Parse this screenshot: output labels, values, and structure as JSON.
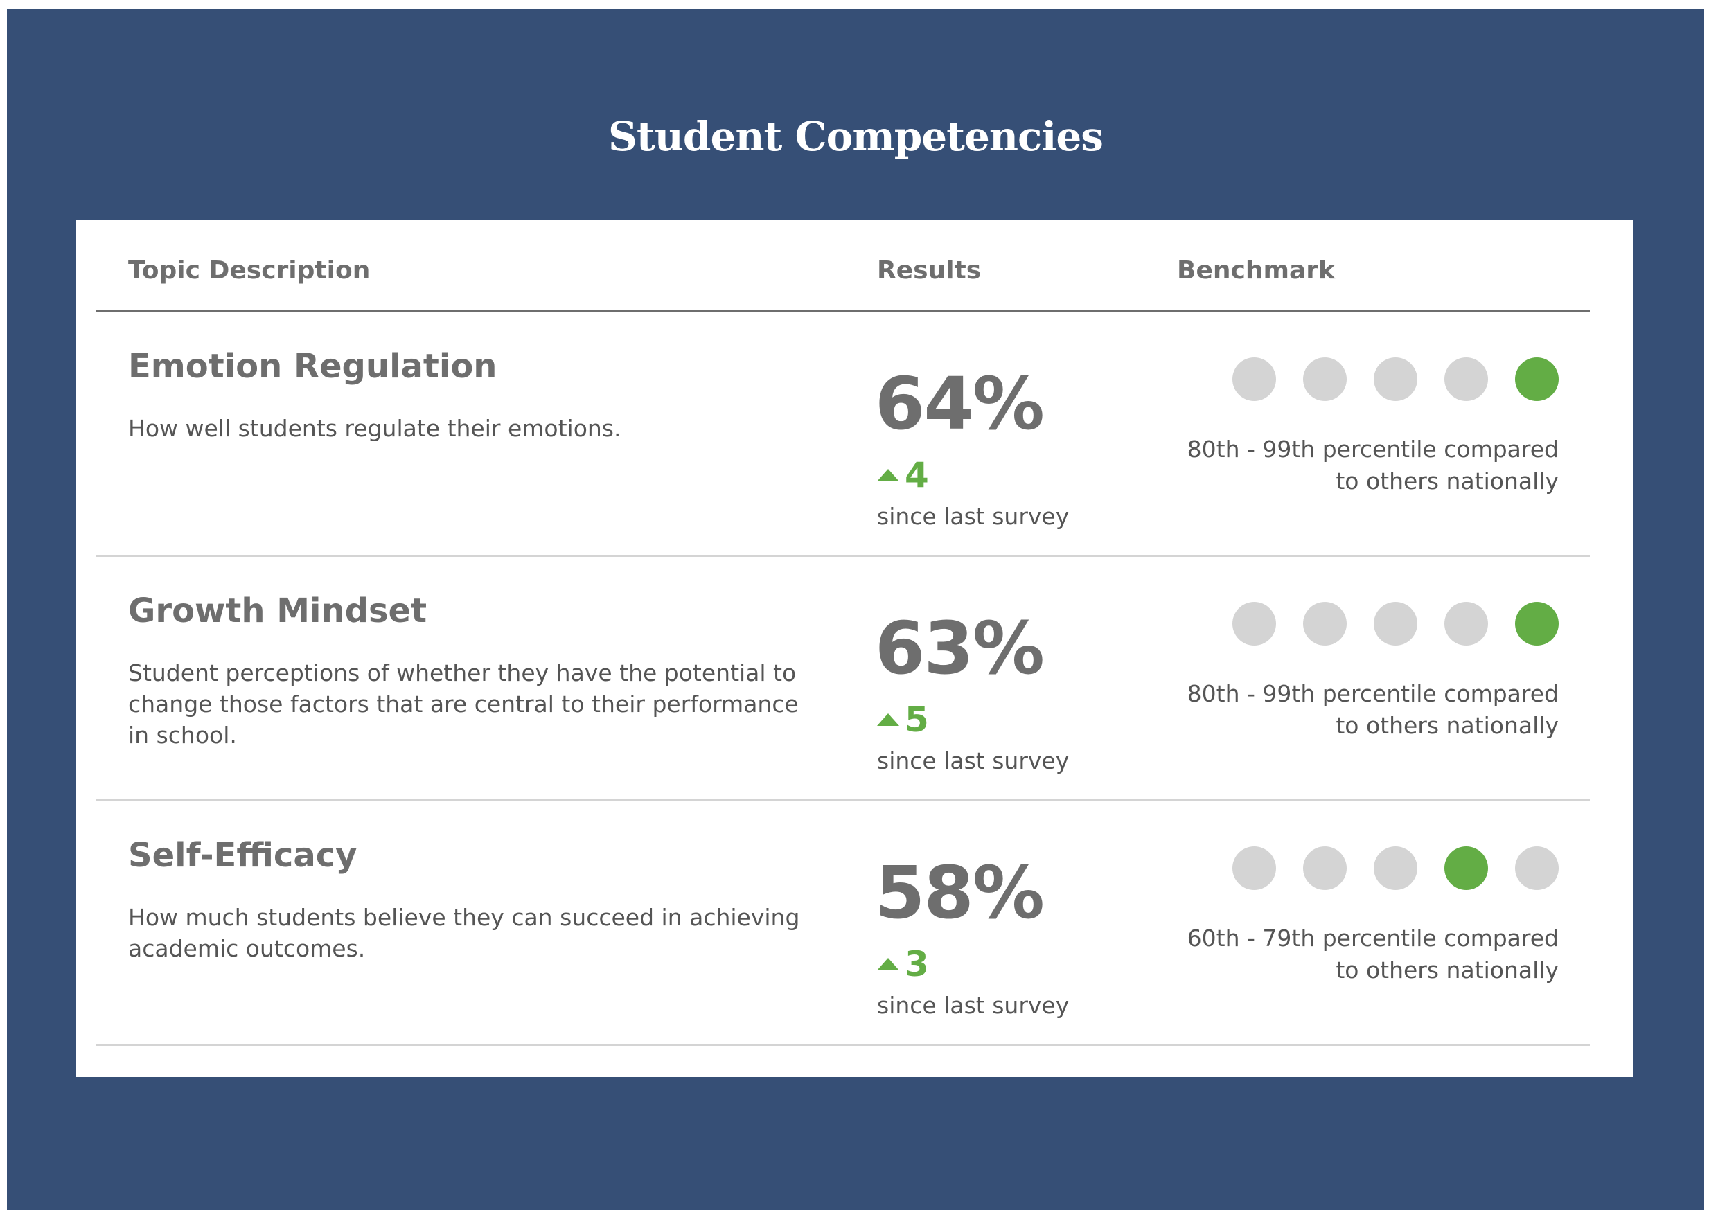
{
  "page": {
    "title": "Student Competencies"
  },
  "table": {
    "headers": {
      "topic": "Topic Description",
      "results": "Results",
      "benchmark": "Benchmark"
    },
    "rows": [
      {
        "name": "Emotion Regulation",
        "description": "How well students regulate their emotions.",
        "result": "64%",
        "change": "4",
        "change_direction": "up",
        "since": "since last survey",
        "benchmark_level": 5,
        "benchmark_total": 5,
        "benchmark_text": "80th - 99th percentile compared to others nationally"
      },
      {
        "name": "Growth Mindset",
        "description": "Student perceptions of whether they have the potential to change those factors that are central to their performance in school.",
        "result": "63%",
        "change": "5",
        "change_direction": "up",
        "since": "since last survey",
        "benchmark_level": 5,
        "benchmark_total": 5,
        "benchmark_text": "80th - 99th percentile compared to others nationally"
      },
      {
        "name": "Self-Efficacy",
        "description": "How much students believe they can succeed in achieving academic outcomes.",
        "result": "58%",
        "change": "3",
        "change_direction": "up",
        "since": "since last survey",
        "benchmark_level": 4,
        "benchmark_total": 5,
        "benchmark_text": "60th - 79th percentile compared to others nationally"
      }
    ]
  },
  "colors": {
    "background": "#364f76",
    "accent_green": "#63ad45",
    "inactive_dot": "#d4d4d4",
    "heading_gray": "#6e6e6e"
  },
  "icons": {
    "change_indicator": "triangle-up-icon"
  }
}
